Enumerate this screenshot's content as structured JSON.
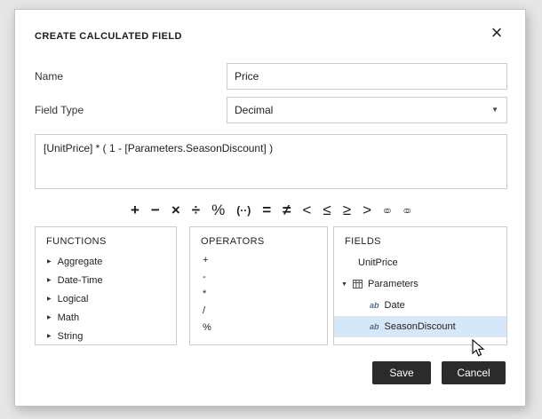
{
  "dialog": {
    "title": "CREATE CALCULATED FIELD",
    "close_glyph": "×",
    "fields": {
      "name_label": "Name",
      "name_value": "Price",
      "type_label": "Field Type",
      "type_value": "Decimal",
      "expression": "[UnitPrice] * ( 1 - [Parameters.SeasonDiscount] )"
    },
    "buttons": {
      "save": "Save",
      "cancel": "Cancel"
    }
  },
  "icons": {
    "collapsed": "▶",
    "expanded": "▼",
    "dropdown": "▼"
  },
  "toolbar": {
    "operators": [
      {
        "name": "plus",
        "glyph": "+"
      },
      {
        "name": "minus",
        "glyph": "−"
      },
      {
        "name": "multiply",
        "glyph": "×"
      },
      {
        "name": "divide",
        "glyph": "÷"
      },
      {
        "name": "percent",
        "glyph": "%"
      },
      {
        "name": "parentheses",
        "glyph": "(··)"
      },
      {
        "name": "equals",
        "glyph": "="
      },
      {
        "name": "not-equals",
        "glyph": "≠"
      },
      {
        "name": "less-than",
        "glyph": "<"
      },
      {
        "name": "less-or-equal",
        "glyph": "≤"
      },
      {
        "name": "greater-or-equal",
        "glyph": "≥"
      },
      {
        "name": "greater-than",
        "glyph": ">"
      },
      {
        "name": "overlap-circles",
        "glyph": "○○"
      },
      {
        "name": "linked-circles",
        "glyph": "○○"
      }
    ]
  },
  "panels": {
    "functions": {
      "header": "FUNCTIONS",
      "items": [
        "Aggregate",
        "Date-Time",
        "Logical",
        "Math",
        "String"
      ]
    },
    "operators": {
      "header": "OPERATORS",
      "items": [
        "+",
        "-",
        "*",
        "/",
        "%"
      ]
    },
    "fields": {
      "header": "FIELDS",
      "items": [
        {
          "label": "UnitPrice"
        },
        {
          "label": "Parameters"
        },
        {
          "label": "Date"
        },
        {
          "label": "SeasonDiscount"
        }
      ]
    }
  },
  "colors": {
    "selection": "#d6e8f7",
    "button_bg": "#2b2b2b"
  }
}
